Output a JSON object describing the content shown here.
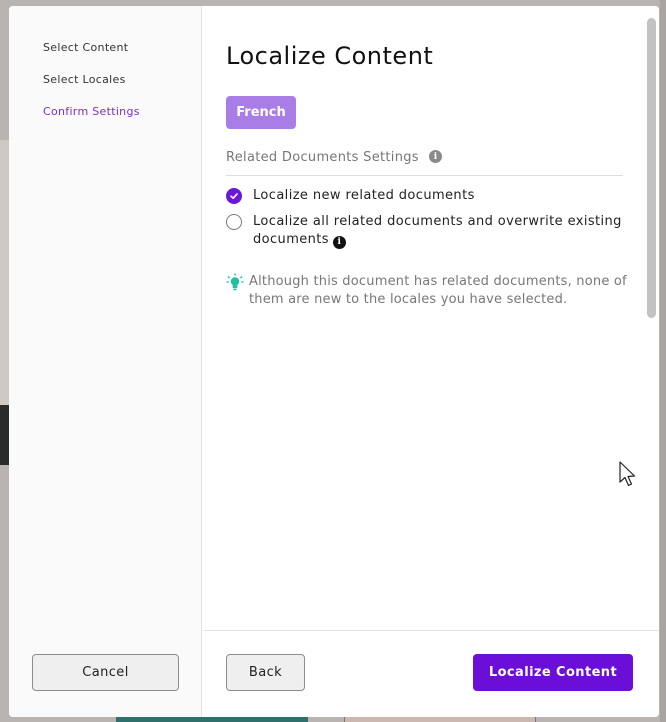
{
  "sidebar": {
    "steps": [
      {
        "label": "Select Content"
      },
      {
        "label": "Select Locales"
      },
      {
        "label": "Confirm Settings"
      }
    ]
  },
  "main": {
    "title": "Localize Content",
    "locale_chip": "French",
    "section_label": "Related Documents Settings",
    "options": [
      {
        "label": "Localize new related documents",
        "checked": true
      },
      {
        "label": "Localize all related documents and overwrite existing documents",
        "checked": false
      }
    ],
    "tip": "Although this document has related documents, none of them are new to the locales you have selected."
  },
  "footer": {
    "cancel_label": "Cancel",
    "back_label": "Back",
    "submit_label": "Localize Content"
  },
  "colors": {
    "accent": "#6b0fd8",
    "chip": "#a97de6",
    "active_step": "#7b2fd0",
    "tip_icon": "#1fbfa3"
  },
  "icons": [
    "info-icon",
    "check-icon",
    "lightbulb-icon",
    "cursor-icon"
  ]
}
